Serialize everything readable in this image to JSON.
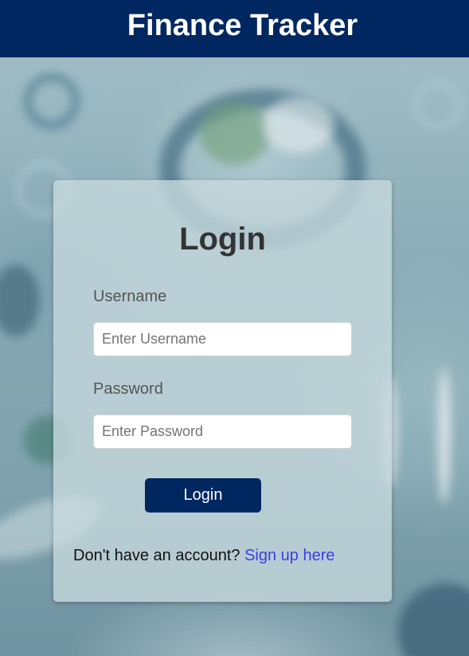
{
  "header": {
    "title": "Finance Tracker"
  },
  "login_form": {
    "heading": "Login",
    "username_label": "Username",
    "username_placeholder": "Enter Username",
    "username_value": "",
    "password_label": "Password",
    "password_placeholder": "Enter Password",
    "password_value": "",
    "submit_label": "Login",
    "signup_prompt": "Don't have an account?",
    "signup_link": "Sign up here"
  },
  "colors": {
    "header_bg": "#012761",
    "button_bg": "#012761",
    "link": "#3b3ee8"
  }
}
